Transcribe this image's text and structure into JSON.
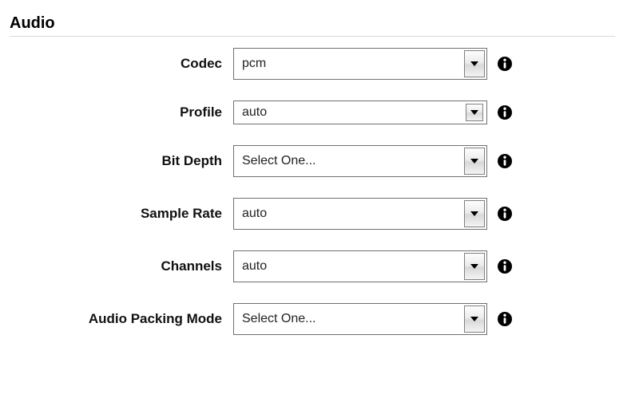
{
  "section": {
    "title": "Audio"
  },
  "fields": {
    "codec": {
      "label": "Codec",
      "value": "pcm"
    },
    "profile": {
      "label": "Profile",
      "value": "auto"
    },
    "bit_depth": {
      "label": "Bit Depth",
      "value": "Select One..."
    },
    "sample_rate": {
      "label": "Sample Rate",
      "value": "auto"
    },
    "channels": {
      "label": "Channels",
      "value": "auto"
    },
    "audio_packing_mode": {
      "label": "Audio Packing Mode",
      "value": "Select One..."
    }
  }
}
